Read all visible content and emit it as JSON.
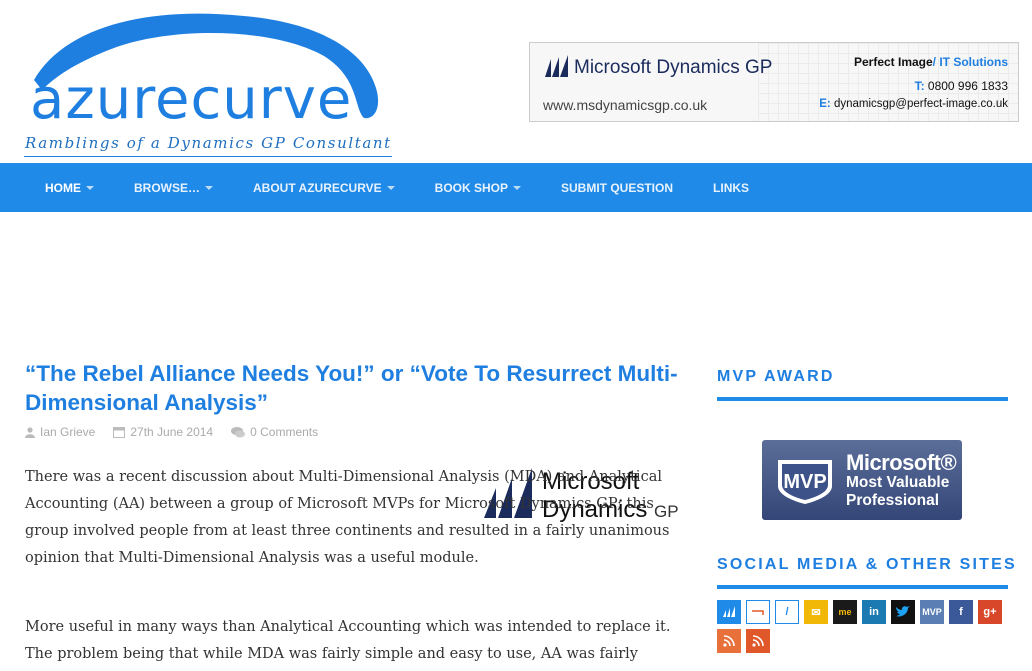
{
  "header": {
    "logo_text": "azurecurve",
    "tagline": "Ramblings of a Dynamics GP Consultant"
  },
  "ad": {
    "brand": "Microsoft Dynamics GP",
    "url": "www.msdynamicsgp.co.uk",
    "company_main": "Perfect Image",
    "company_sub": "/ IT Solutions",
    "phone_label": "T:",
    "phone": "0800 996 1833",
    "email_label": "E:",
    "email": "dynamicsgp@perfect-image.co.uk"
  },
  "nav": {
    "items": [
      {
        "label": "Home",
        "dropdown": true
      },
      {
        "label": "Browse…",
        "dropdown": true
      },
      {
        "label": "About azurecurve",
        "dropdown": true
      },
      {
        "label": "Book Shop",
        "dropdown": true
      },
      {
        "label": "Submit Question",
        "dropdown": false
      },
      {
        "label": "Links",
        "dropdown": false
      }
    ]
  },
  "post": {
    "title": "“The Rebel Alliance Needs You!” or “Vote To Resurrect Multi-Dimensional Analysis”",
    "author": "Ian Grieve",
    "date": "27th June 2014",
    "comments": "0 Comments",
    "image_line1": "Microsoft",
    "image_line2": "Dynamics",
    "image_line2_suffix": "GP",
    "p1": "There was a recent discussion about Multi-Dimensional Analysis (MDA) and Analytical Accounting (AA) between a group of Microsoft MVPs for Microsoft Dynamics GP; this group involved people from at least three continents and resulted in a fairly unanimous opinion that Multi-Dimensional Analysis was a useful module.",
    "p2": "More useful in many ways than Analytical Accounting which was intended to replace it. The problem being that while MDA was fairly simple and easy to use, AA was fairly"
  },
  "sidebar": {
    "mvp_title": "MVP Award",
    "mvp_badge_line1": "Microsoft®",
    "mvp_badge_line2": "Most Valuable",
    "mvp_badge_line3": "Professional",
    "mvp_badge_shield": "MVP",
    "social_title": "Social Media & Other Sites",
    "social_icons": [
      {
        "name": "dynamics-gp-icon",
        "glyph": "",
        "bg": "#1f8ae8"
      },
      {
        "name": "link-icon",
        "glyph": "",
        "bg": "#ffffff"
      },
      {
        "name": "slash-icon",
        "glyph": "/",
        "bg": "#ffffff"
      },
      {
        "name": "email-icon",
        "glyph": "✉",
        "bg": "#f2b807"
      },
      {
        "name": "me-icon",
        "glyph": "me",
        "bg": "#1a1a1a"
      },
      {
        "name": "linkedin-icon",
        "glyph": "in",
        "bg": "#1c7ab3"
      },
      {
        "name": "twitter-icon",
        "glyph": "",
        "bg": "#111111"
      },
      {
        "name": "mvp-icon",
        "glyph": "MVP",
        "bg": "#5b7fb5"
      },
      {
        "name": "facebook-icon",
        "glyph": "f",
        "bg": "#3b5998"
      },
      {
        "name": "google-plus-icon",
        "glyph": "g+",
        "bg": "#d9472b"
      },
      {
        "name": "rss-icon",
        "glyph": "",
        "bg": "#e8703a"
      },
      {
        "name": "rss-feed-icon",
        "glyph": "",
        "bg": "#e0582a"
      }
    ]
  }
}
